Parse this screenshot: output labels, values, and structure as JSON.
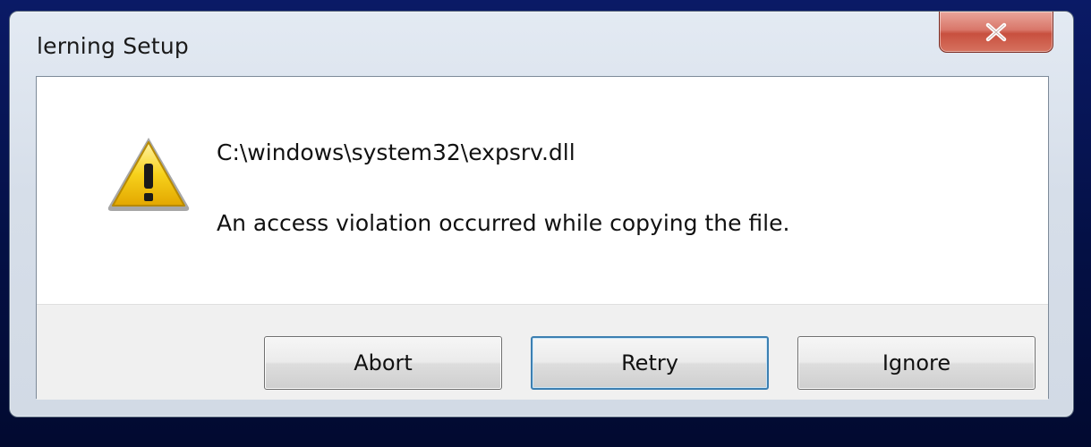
{
  "dialog": {
    "title": "lerning Setup",
    "close_icon": "close-x-icon",
    "message": {
      "icon": "warning-icon",
      "path": "C:\\windows\\system32\\expsrv.dll",
      "text": "An access violation occurred while copying the file."
    },
    "buttons": {
      "abort": "Abort",
      "retry": "Retry",
      "ignore": "Ignore"
    },
    "colors": {
      "close_button": "#d6725f",
      "warning_yellow": "#f4c20d",
      "default_button_border": "#3c7fb1"
    }
  }
}
